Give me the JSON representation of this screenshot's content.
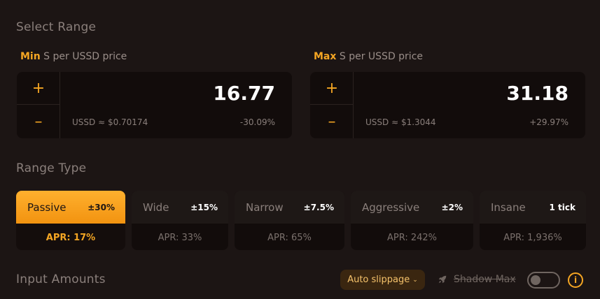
{
  "select_range": {
    "title": "Select Range",
    "min": {
      "accent": "Min",
      "label": "S per USSD price",
      "value": "16.77",
      "usd": "USSD ≈ $0.70174",
      "change": "-30.09%"
    },
    "max": {
      "accent": "Max",
      "label": "S per USSD price",
      "value": "31.18",
      "usd": "USSD ≈ $1.3044",
      "change": "+29.97%"
    },
    "plus_symbol": "+",
    "minus_symbol": "–"
  },
  "range_type": {
    "title": "Range Type",
    "options": [
      {
        "name": "Passive",
        "spread": "±30%",
        "apr": "APR: 17%",
        "active": true
      },
      {
        "name": "Wide",
        "spread": "±15%",
        "apr": "APR: 33%",
        "active": false
      },
      {
        "name": "Narrow",
        "spread": "±7.5%",
        "apr": "APR: 65%",
        "active": false
      },
      {
        "name": "Aggressive",
        "spread": "±2%",
        "apr": "APR: 242%",
        "active": false
      },
      {
        "name": "Insane",
        "spread": "1 tick",
        "apr": "APR: 1,936%",
        "active": false
      }
    ]
  },
  "input_amounts": {
    "title": "Input Amounts",
    "slippage_label": "Auto slippage",
    "slippage_chevron": "⌄",
    "shadow_max_label": "Shadow Max",
    "shadow_max_enabled": false,
    "info_symbol": "i"
  },
  "colors": {
    "background": "#1c1514",
    "accent": "#f5a623",
    "panel": "#120c0b"
  }
}
